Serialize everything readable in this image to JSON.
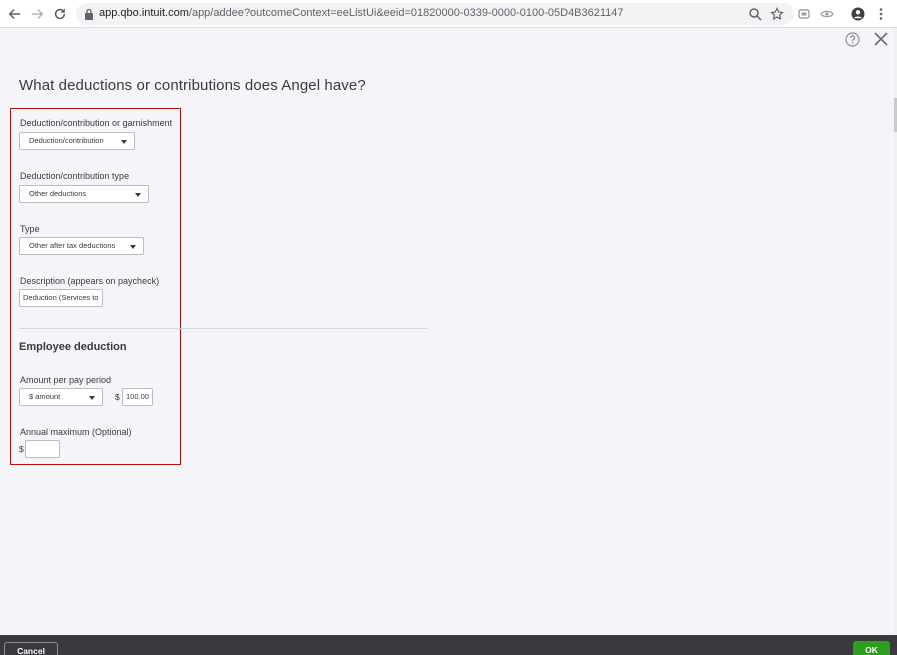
{
  "browser": {
    "url_host": "app.qbo.intuit.com",
    "url_path": "/app/addee?outcomeContext=eeListUi&eeid=01820000-0339-0000-0100-05D4B3621147"
  },
  "dialog": {
    "title": "What deductions or contributions does Angel have?",
    "fields": {
      "deduction_category": {
        "label": "Deduction/contribution or garnishment",
        "value": "Deduction/contribution"
      },
      "deduction_type": {
        "label": "Deduction/contribution type",
        "value": "Other deductions"
      },
      "type": {
        "label": "Type",
        "value": "Other after tax deductions"
      },
      "description": {
        "label": "Description (appears on paycheck)",
        "value": "Deduction (Services to"
      }
    },
    "employee_deduction": {
      "heading": "Employee deduction",
      "amount_label": "Amount per pay period",
      "amount_type": "$ amount",
      "currency_symbol": "$",
      "amount_value": "100.00",
      "annual_max_label": "Annual maximum  (Optional)",
      "annual_max_currency": "$",
      "annual_max_value": ""
    }
  },
  "footer": {
    "cancel_label": "Cancel",
    "ok_label": "OK"
  },
  "colors": {
    "highlight_border": "#b01216",
    "ok_green": "#2ca01c",
    "footer_bg": "#393a3d"
  }
}
